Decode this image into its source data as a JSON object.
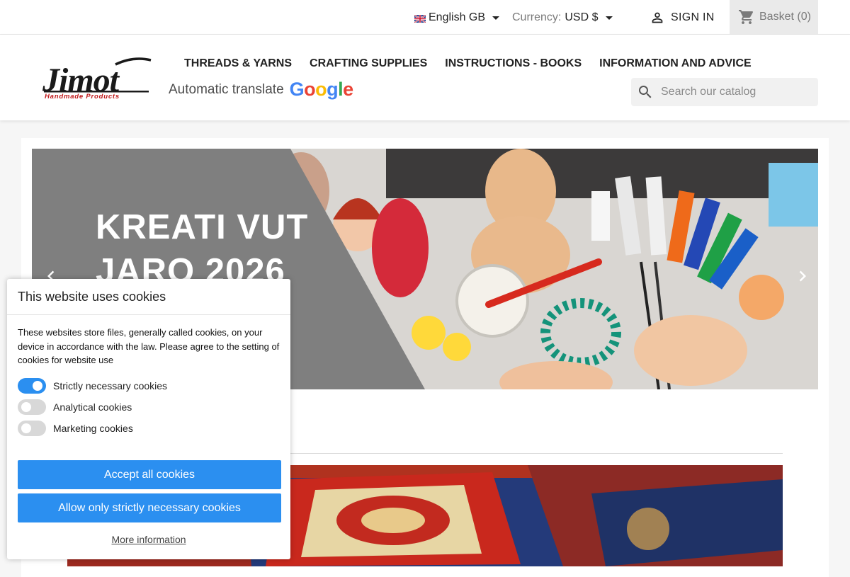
{
  "topbar": {
    "language": "English GB",
    "currency_label": "Currency:",
    "currency_value": "USD $",
    "sign_in": "SIGN IN",
    "basket": "Basket (0)"
  },
  "header": {
    "logo_text": "Jimot",
    "logo_subtext": "Handmade Products",
    "nav": [
      "THREADS & YARNS",
      "CRAFTING SUPPLIES",
      "INSTRUCTIONS - BOOKS",
      "INFORMATION AND ADVICE"
    ],
    "translate_label": "Automatic translate",
    "translate_brand": "Google",
    "search_placeholder": "Search our catalog"
  },
  "slider": {
    "title": "KREATI VUT JARO 2026"
  },
  "cookie_dialog": {
    "title": "This website uses cookies",
    "description": "These websites store files, generally called cookies, on your device in accordance with the law. Please agree to the setting of cookies for website use",
    "toggles": [
      {
        "label": "Strictly necessary cookies",
        "enabled": true
      },
      {
        "label": "Analytical cookies",
        "enabled": false
      },
      {
        "label": "Marketing cookies",
        "enabled": false
      }
    ],
    "accept_all": "Accept all cookies",
    "allow_necessary": "Allow only strictly necessary cookies",
    "more_info": "More information"
  },
  "colors": {
    "accent_blue": "#2b8ff0",
    "google_blue": "#4285F4",
    "google_red": "#EA4335",
    "google_yellow": "#FBBC05",
    "google_green": "#34A853"
  }
}
